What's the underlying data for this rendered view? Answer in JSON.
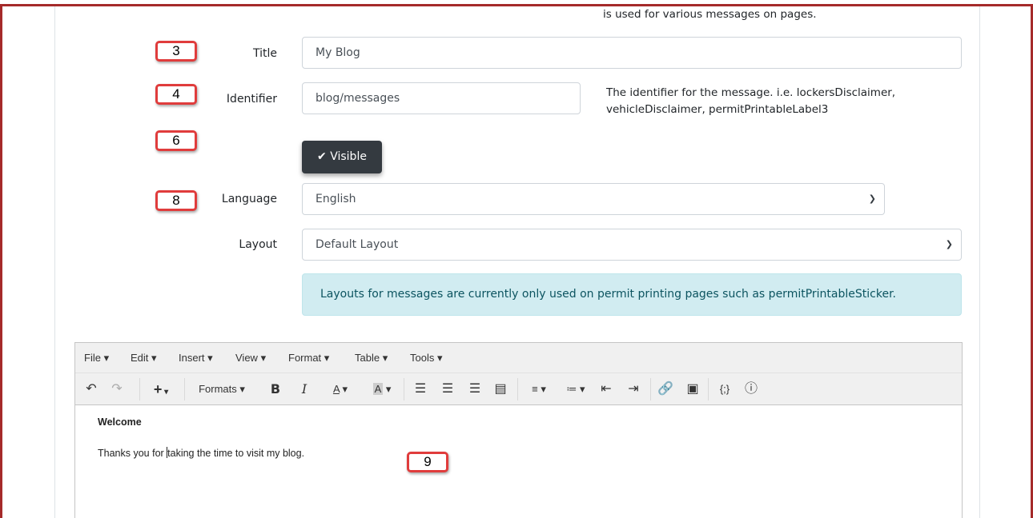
{
  "top_help": "is used for various messages on pages.",
  "callouts": [
    "3",
    "4",
    "6",
    "8",
    "9"
  ],
  "form": {
    "title_label": "Title",
    "title_value": "My Blog",
    "identifier_label": "Identifier",
    "identifier_value": "blog/messages",
    "identifier_help_1": "The identifier for the message. i.e. lockersDisclaimer,",
    "identifier_help_2": "vehicleDisclaimer, permitPrintableLabel3",
    "visible_button": "Visible",
    "language_label": "Language",
    "language_value": "English",
    "layout_label": "Layout",
    "layout_value": "Default Layout",
    "layout_alert": "Layouts for messages are currently only used on permit printing pages such as permitPrintableSticker."
  },
  "editor": {
    "menu": [
      "File",
      "Edit",
      "Insert",
      "View",
      "Format",
      "Table",
      "Tools"
    ],
    "formats_label": "Formats",
    "content_heading": "Welcome",
    "content_before_cursor": "Thanks you for ",
    "content_after_cursor": "taking the time to visit my blog."
  },
  "icons": {
    "undo": "undo-icon",
    "redo": "redo-icon",
    "insert": "plus-icon",
    "bold": "bold-icon",
    "italic": "italic-icon",
    "text_color": "text-color-icon",
    "bg_color": "background-color-icon",
    "align_left": "align-left-icon",
    "align_center": "align-center-icon",
    "align_right": "align-right-icon",
    "justify": "align-justify-icon",
    "bullist": "bullet-list-icon",
    "numlist": "numbered-list-icon",
    "outdent": "outdent-icon",
    "indent": "indent-icon",
    "link": "link-icon",
    "image": "image-icon",
    "code": "code-icon",
    "help": "help-icon",
    "checkmark": "checkmark-icon"
  },
  "colors": {
    "frame": "#a52a2a",
    "callout_border": "#e03c3c",
    "button_dark": "#343a40",
    "alert_bg": "#d1ecf1",
    "alert_text": "#0c5460"
  }
}
